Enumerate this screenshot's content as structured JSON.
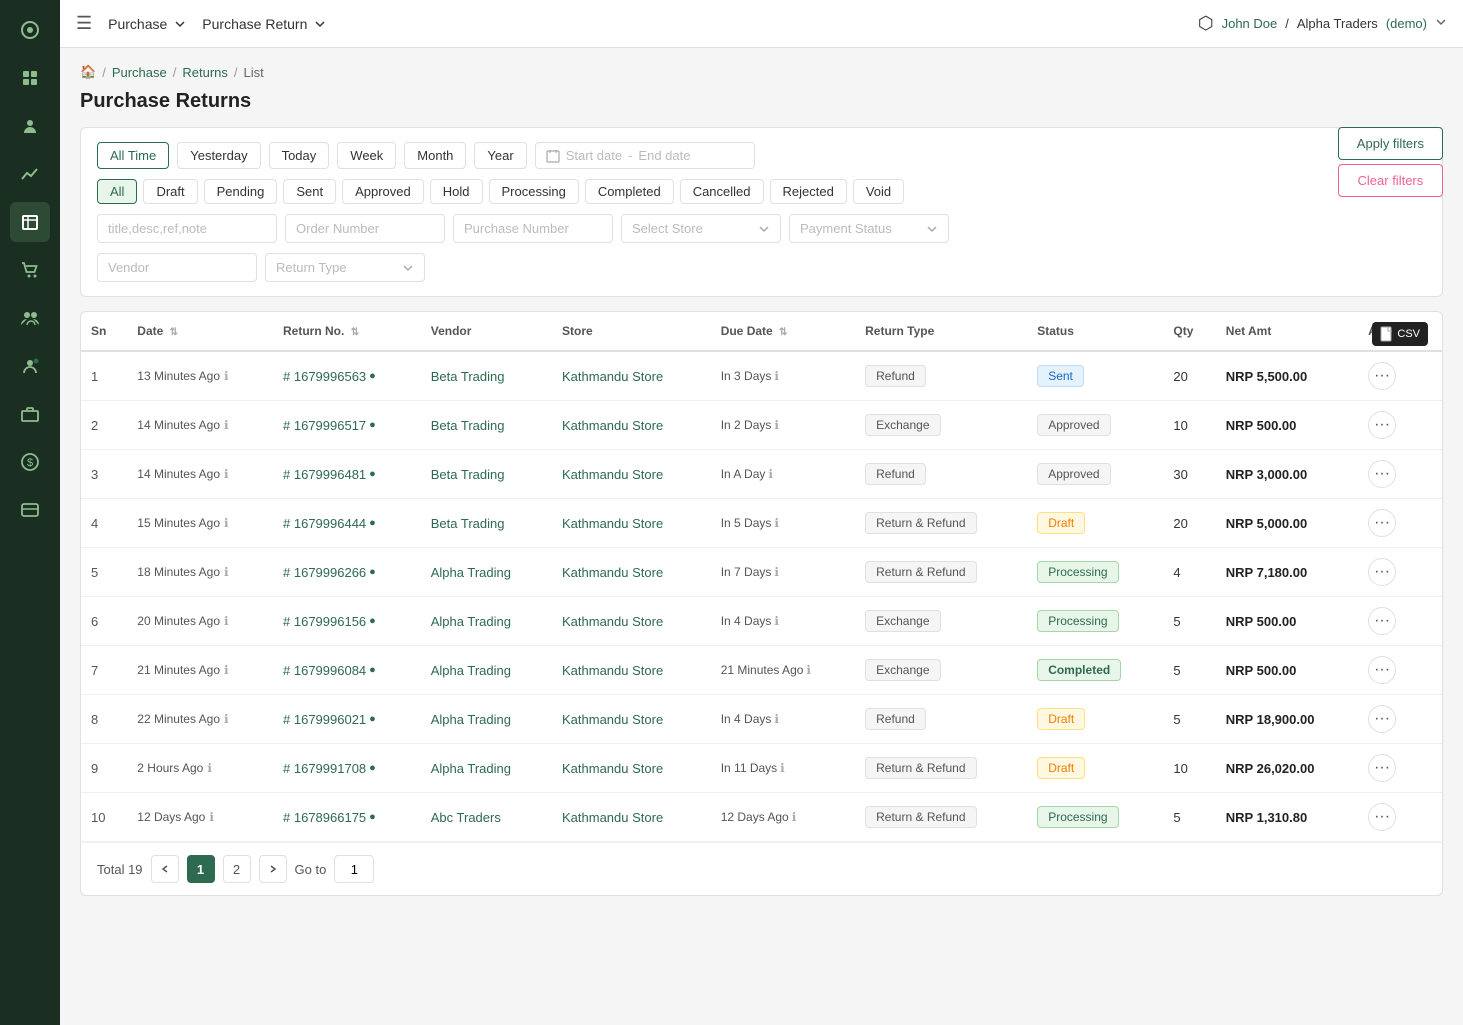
{
  "sidebar": {
    "icons": [
      {
        "name": "dashboard-icon",
        "symbol": "⬡"
      },
      {
        "name": "users-icon",
        "symbol": "👤"
      },
      {
        "name": "person-icon",
        "symbol": "🧑"
      },
      {
        "name": "chart-icon",
        "symbol": "📊"
      },
      {
        "name": "building-icon",
        "symbol": "🏢"
      },
      {
        "name": "cart-icon",
        "symbol": "🛒"
      },
      {
        "name": "people-icon",
        "symbol": "👥"
      },
      {
        "name": "user-admin-icon",
        "symbol": "👤"
      },
      {
        "name": "briefcase-icon",
        "symbol": "💼"
      },
      {
        "name": "dollar-icon",
        "symbol": "💰"
      },
      {
        "name": "team-icon",
        "symbol": "👔"
      }
    ]
  },
  "navbar": {
    "hamburger_label": "☰",
    "menu1_label": "Purchase",
    "menu2_label": "Purchase Return",
    "user_name": "John Doe",
    "company": "Alpha Traders",
    "demo_label": "(demo)"
  },
  "breadcrumb": {
    "home": "🏠",
    "purchase": "Purchase",
    "returns": "Returns",
    "list": "List"
  },
  "page_title": "Purchase Returns",
  "filters": {
    "time_buttons": [
      {
        "label": "All Time",
        "active": true
      },
      {
        "label": "Yesterday",
        "active": false
      },
      {
        "label": "Today",
        "active": false
      },
      {
        "label": "Week",
        "active": false
      },
      {
        "label": "Month",
        "active": false
      },
      {
        "label": "Year",
        "active": false
      }
    ],
    "date_start_placeholder": "Start date",
    "date_end_placeholder": "End date",
    "status_buttons": [
      {
        "label": "All",
        "active": true
      },
      {
        "label": "Draft",
        "active": false
      },
      {
        "label": "Pending",
        "active": false
      },
      {
        "label": "Sent",
        "active": false
      },
      {
        "label": "Approved",
        "active": false
      },
      {
        "label": "Hold",
        "active": false
      },
      {
        "label": "Processing",
        "active": false
      },
      {
        "label": "Completed",
        "active": false
      },
      {
        "label": "Cancelled",
        "active": false
      },
      {
        "label": "Rejected",
        "active": false
      },
      {
        "label": "Void",
        "active": false
      }
    ],
    "search_placeholder": "title,desc,ref,note",
    "order_number_placeholder": "Order Number",
    "purchase_number_placeholder": "Purchase Number",
    "select_store_placeholder": "Select Store",
    "payment_status_placeholder": "Payment Status",
    "vendor_placeholder": "Vendor",
    "return_type_placeholder": "Return Type",
    "apply_label": "Apply filters",
    "clear_label": "Clear filters"
  },
  "table": {
    "columns": [
      "Sn",
      "Date",
      "Return No.",
      "Vendor",
      "Store",
      "Due Date",
      "Return Type",
      "Status",
      "Qty",
      "Net Amt",
      "Actions"
    ],
    "rows": [
      {
        "sn": 1,
        "date": "13 Minutes Ago",
        "return_no": "# 1679996563",
        "vendor": "Beta Trading",
        "store": "Kathmandu Store",
        "due_date": "In 3 Days",
        "return_type": "Refund",
        "status": "Sent",
        "status_class": "status-sent",
        "qty": 20,
        "net_amt": "NRP 5,500.00"
      },
      {
        "sn": 2,
        "date": "14 Minutes Ago",
        "return_no": "# 1679996517",
        "vendor": "Beta Trading",
        "store": "Kathmandu Store",
        "due_date": "In 2 Days",
        "return_type": "Exchange",
        "status": "Approved",
        "status_class": "status-approved",
        "qty": 10,
        "net_amt": "NRP 500.00"
      },
      {
        "sn": 3,
        "date": "14 Minutes Ago",
        "return_no": "# 1679996481",
        "vendor": "Beta Trading",
        "store": "Kathmandu Store",
        "due_date": "In A Day",
        "return_type": "Refund",
        "status": "Approved",
        "status_class": "status-approved",
        "qty": 30,
        "net_amt": "NRP 3,000.00"
      },
      {
        "sn": 4,
        "date": "15 Minutes Ago",
        "return_no": "# 1679996444",
        "vendor": "Beta Trading",
        "store": "Kathmandu Store",
        "due_date": "In 5 Days",
        "return_type": "Return & Refund",
        "status": "Draft",
        "status_class": "status-draft",
        "qty": 20,
        "net_amt": "NRP 5,000.00"
      },
      {
        "sn": 5,
        "date": "18 Minutes Ago",
        "return_no": "# 1679996266",
        "vendor": "Alpha Trading",
        "store": "Kathmandu Store",
        "due_date": "In 7 Days",
        "return_type": "Return & Refund",
        "status": "Processing",
        "status_class": "status-processing",
        "qty": 4,
        "net_amt": "NRP 7,180.00"
      },
      {
        "sn": 6,
        "date": "20 Minutes Ago",
        "return_no": "# 1679996156",
        "vendor": "Alpha Trading",
        "store": "Kathmandu Store",
        "due_date": "In 4 Days",
        "return_type": "Exchange",
        "status": "Processing",
        "status_class": "status-processing",
        "qty": 5,
        "net_amt": "NRP 500.00"
      },
      {
        "sn": 7,
        "date": "21 Minutes Ago",
        "return_no": "# 1679996084",
        "vendor": "Alpha Trading",
        "store": "Kathmandu Store",
        "due_date": "21 Minutes Ago",
        "return_type": "Exchange",
        "status": "Completed",
        "status_class": "status-completed",
        "qty": 5,
        "net_amt": "NRP 500.00"
      },
      {
        "sn": 8,
        "date": "22 Minutes Ago",
        "return_no": "# 1679996021",
        "vendor": "Alpha Trading",
        "store": "Kathmandu Store",
        "due_date": "In 4 Days",
        "return_type": "Refund",
        "status": "Draft",
        "status_class": "status-draft",
        "qty": 5,
        "net_amt": "NRP 18,900.00"
      },
      {
        "sn": 9,
        "date": "2 Hours Ago",
        "return_no": "# 1679991708",
        "vendor": "Alpha Trading",
        "store": "Kathmandu Store",
        "due_date": "In 11 Days",
        "return_type": "Return & Refund",
        "status": "Draft",
        "status_class": "status-draft",
        "qty": 10,
        "net_amt": "NRP 26,020.00"
      },
      {
        "sn": 10,
        "date": "12 Days Ago",
        "return_no": "# 1678966175",
        "vendor": "Abc Traders",
        "store": "Kathmandu Store",
        "due_date": "12 Days Ago",
        "return_type": "Return & Refund",
        "status": "Processing",
        "status_class": "status-processing",
        "qty": 5,
        "net_amt": "NRP 1,310.80"
      }
    ]
  },
  "pagination": {
    "total_label": "Total 19",
    "pages": [
      1,
      2
    ],
    "current_page": 1,
    "goto_label": "Go to",
    "goto_value": "1"
  }
}
